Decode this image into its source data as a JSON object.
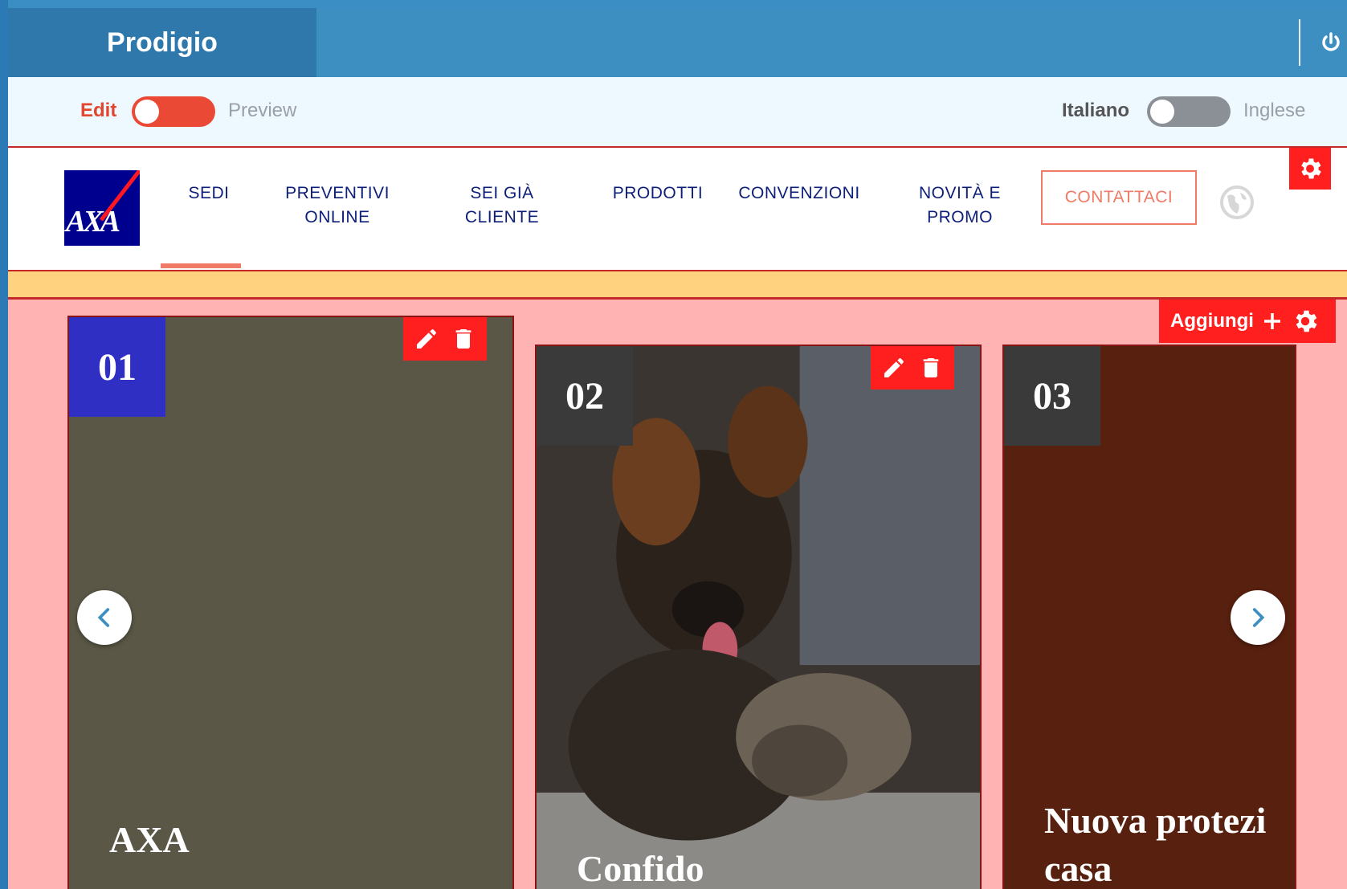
{
  "app": {
    "title": "Prodigio"
  },
  "modebar": {
    "edit_label": "Edit",
    "preview_label": "Preview",
    "lang_left": "Italiano",
    "lang_right": "Inglese"
  },
  "nav": {
    "items": [
      {
        "label": "SEDI",
        "active": true
      },
      {
        "label": "PREVENTIVI ONLINE"
      },
      {
        "label": "SEI GIÀ CLIENTE"
      },
      {
        "label": "PRODOTTI"
      },
      {
        "label": "CONVENZIONI"
      },
      {
        "label": "NOVITÀ E PROMO"
      }
    ],
    "cta_label": "CONTATTACI",
    "logo_text": "AXA"
  },
  "carousel": {
    "add_label": "Aggiungi",
    "cards": [
      {
        "number": "01",
        "title": "AXA",
        "color": "#5a5746"
      },
      {
        "number": "02",
        "title": "Confido",
        "color": "#3f3a33"
      },
      {
        "number": "03",
        "title": "Nuova protezione casa",
        "title_line1": "Nuova protezi",
        "title_line2": "casa",
        "color": "#58200f"
      }
    ]
  },
  "colors": {
    "topbar": "#3d8ec1",
    "accent_red": "#ff1f1f",
    "nav_text": "#0d1f78",
    "cta": "#f07a65",
    "carousel_bg": "#ffb3b3"
  }
}
